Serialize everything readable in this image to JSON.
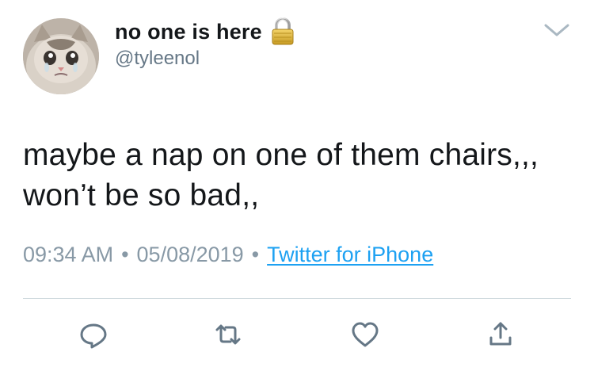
{
  "author": {
    "display_name": "no one is here",
    "handle": "@tyleenol",
    "protected_icon": "lock-icon",
    "avatar_icon": "crying-cat-avatar"
  },
  "menu": {
    "icon": "chevron-down-icon"
  },
  "tweet": {
    "text_line1": "maybe a nap on one of them chairs,,,",
    "text_line2": "won’t be so bad,,"
  },
  "meta": {
    "time": "09:34 AM",
    "separator": "•",
    "date": "05/08/2019",
    "source": "Twitter for iPhone"
  },
  "actions": [
    {
      "name": "reply",
      "icon": "reply-icon"
    },
    {
      "name": "retweet",
      "icon": "retweet-icon"
    },
    {
      "name": "like",
      "icon": "heart-icon"
    },
    {
      "name": "share",
      "icon": "share-icon"
    }
  ],
  "colors": {
    "text_primary": "#14171a",
    "text_secondary": "#657786",
    "meta_gray": "#8899a6",
    "link_blue": "#1da1f2",
    "icon_gray": "#657786",
    "divider": "#cfd9de"
  }
}
